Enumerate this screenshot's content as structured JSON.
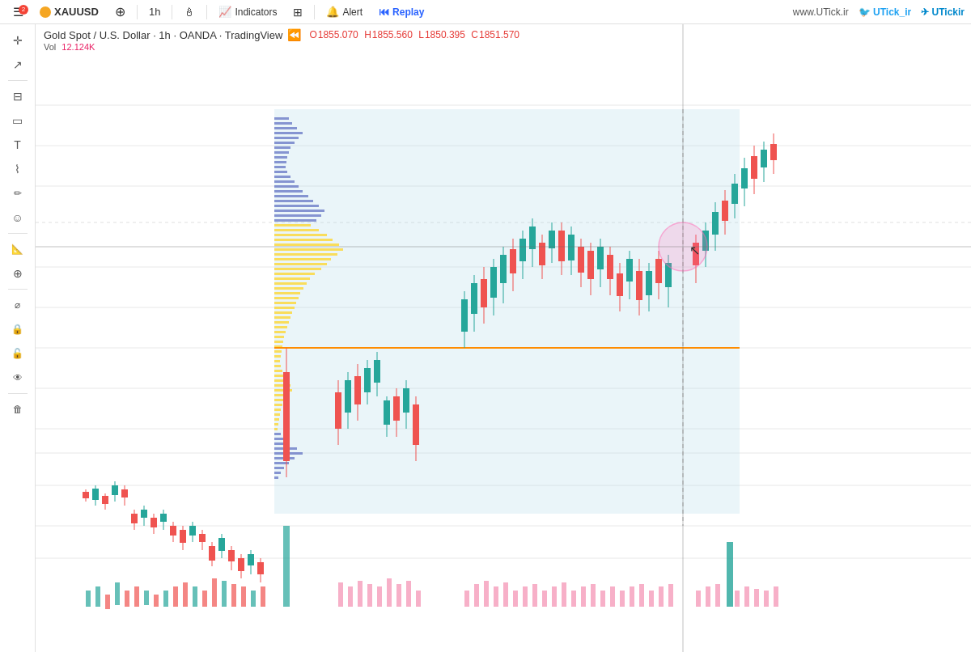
{
  "toolbar": {
    "hamburger": "☰",
    "badge": "2",
    "symbol": "XAUUSD",
    "plus_label": "+",
    "timeframe": "1h",
    "chart_type_icon": "candle",
    "indicators_label": "Indicators",
    "layout_icon": "layout",
    "alert_label": "Alert",
    "replay_label": "Replay",
    "website": "www.UTick.ir",
    "twitter": "UTick_ir",
    "telegram": "UTickir"
  },
  "chart_header": {
    "title": "Gold Spot / U.S. Dollar",
    "separator": "·",
    "timeframe": "1h",
    "broker": "OANDA",
    "source": "TradingView",
    "open_label": "O",
    "open_val": "1855.070",
    "high_label": "H",
    "high_val": "1855.560",
    "low_label": "L",
    "low_val": "1850.395",
    "close_label": "C",
    "close_val": "1851.570",
    "vol_label": "Vol",
    "vol_val": "12.124K"
  },
  "left_toolbar": {
    "items": [
      {
        "name": "crosshair",
        "icon": "✛"
      },
      {
        "name": "arrow",
        "icon": "↗"
      },
      {
        "name": "horizontal-line",
        "icon": "⊟"
      },
      {
        "name": "rectangle",
        "icon": "▭"
      },
      {
        "name": "text",
        "icon": "T"
      },
      {
        "name": "path",
        "icon": "⌇"
      },
      {
        "name": "brush",
        "icon": "🖊"
      },
      {
        "name": "emoji",
        "icon": "☺"
      },
      {
        "name": "ruler",
        "icon": "📐"
      },
      {
        "name": "zoom",
        "icon": "⊕"
      },
      {
        "name": "magnet",
        "icon": "🧲"
      },
      {
        "name": "lock",
        "icon": "🔒"
      },
      {
        "name": "lock2",
        "icon": "🔓"
      },
      {
        "name": "eye",
        "icon": "👁"
      },
      {
        "name": "trash",
        "icon": "🗑"
      }
    ]
  },
  "colors": {
    "bull_candle": "#26a69a",
    "bear_candle": "#ef5350",
    "volume_bull": "#26a69a",
    "volume_bear": "#ef5350",
    "volume_pink": "#f48fb1",
    "highlight_bg": "rgba(173,216,230,0.3)",
    "vp_blue": "#5c6bc0",
    "vp_yellow": "#fdd835",
    "orange_line": "#ff8c00",
    "grid_line": "#e8e8e8",
    "accent": "#2962ff"
  }
}
